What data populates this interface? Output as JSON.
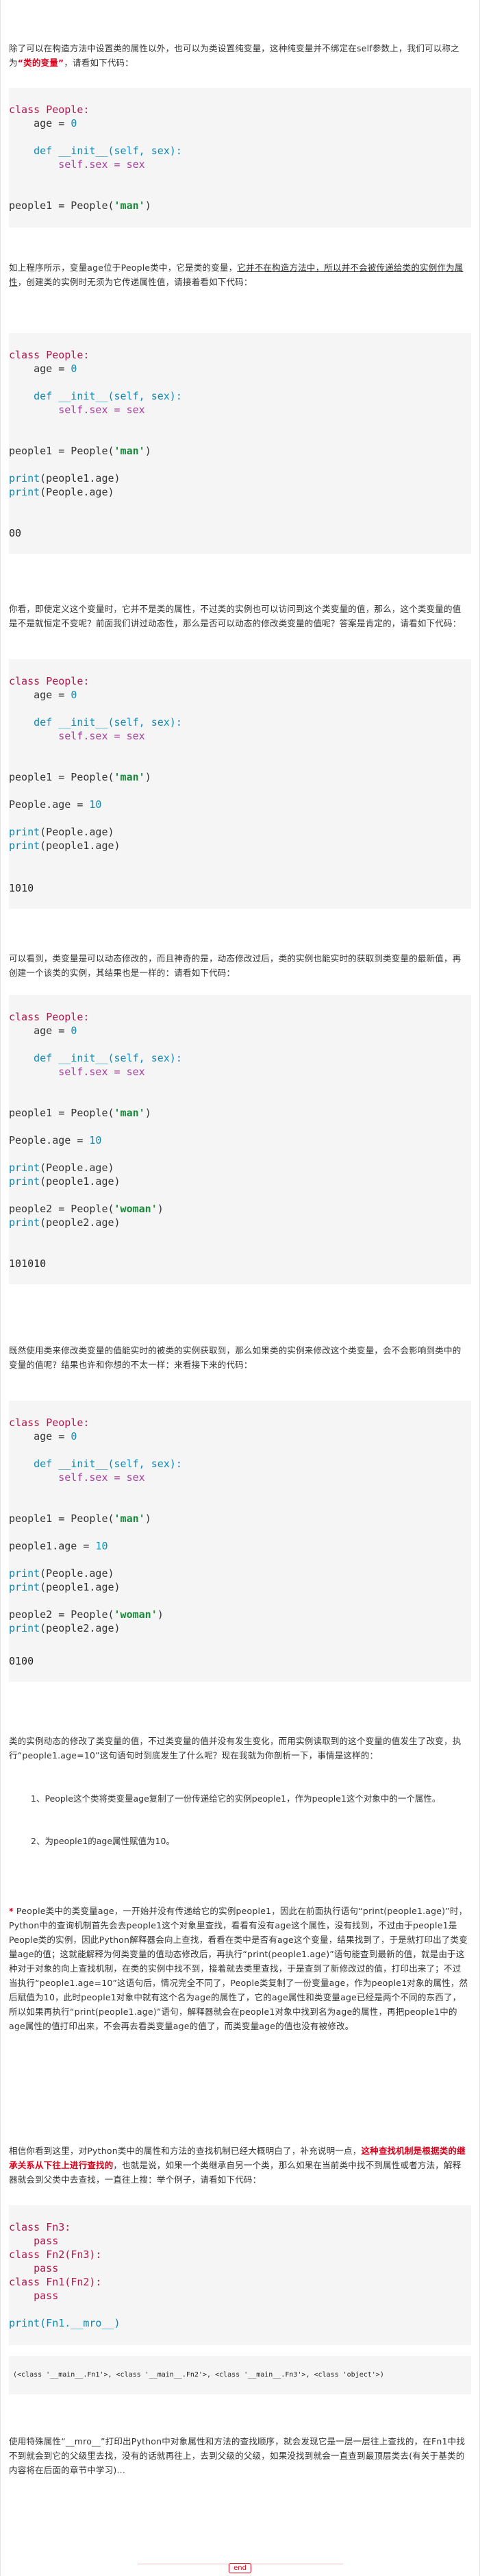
{
  "intro": {
    "p1_a": "除了可以在构造方法中设置类的属性以外，也可以为类设置纯变量，这种纯变量并不绑定在self参数上，我们可以称之为",
    "p1_b": "“类的变量”",
    "p1_c": "，请看如下代码：",
    "p2_a": "如上程序所示，变量age位于People类中，它是类的变量，",
    "p2_b": "它并不在构造方法中，所以并不会被传递给类的实例作为属性",
    "p2_c": "，创建类的实例时无须为它传递属性值，请接着看如下代码：",
    "p3": "你看，即使定义这个变量时，它并不是类的属性，不过类的实例也可以访问到这个类变量的值，那么，这个类变量的值是不是就恒定不变呢？前面我们讲过动态性，那么是否可以动态的修改类变量的值呢？答案是肯定的，请看如下代码：",
    "p4": "可以看到，类变量是可以动态修改的，而且神奇的是，动态修改过后，类的实例也能实时的获取到类变量的最新值，再创建一个该类的实例，其结果也是一样的：请看如下代码：",
    "p5": "既然使用类来修改类变量的值能实时的被类的实例获取到，那么如果类的实例来修改这个类变量，会不会影响到类中的变量的值呢？结果也许和你想的不太一样：来看接下来的代码：",
    "p6": "类的实例动态的修改了类变量的值，不过类变量的值并没有发生变化，而用实例读取到的这个变量的值发生了改变，执行“people1.age=10”这句语句时到底发生了什么呢？现在我就为你剖析一下，事情是这样的：",
    "list1": "1、People这个类将类变量age复制了一份传递给它的实例people1，作为people1这个对象中的一个属性。",
    "list2": "2、为people1的age属性赋值为10。",
    "p7_star": "*",
    "p7": " People类中的类变量age，一开始并没有传递给它的实例people1，因此在前面执行语句“print(people1.age)”时，Python中的查询机制首先会去people1这个对象里查找，看看有没有age这个属性，没有找到，不过由于people1是People类的实例，因此Python解释器会向上查找，看看在类中是否有age这个变量，结果找到了，于是就打印出了类变量age的值；这就能解释为何类变量的值动态修改后，再执行“print(people1.age)”语句能查到最新的值，就是由于这种对于对象的向上查找机制，在类的实例中找不到，接着就去类里查找，于是查到了新修改过的值，打印出来了；不过当执行“people1.age=10”这语句后，情况完全不同了，People类复制了一份变量age，作为people1对象的属性，然后赋值为10，此时people1对象中就有这个名为age的属性了，它的age属性和类变量age已经是两个不同的东西了，所以如果再执行“print(people1.age)”语句，解释器就会在people1对象中找到名为age的属性，再把people1中的age属性的值打印出来，不会再去看类变量age的值了，而类变量age的值也没有被修改。",
    "p8_a": "相信你看到这里，对Python类中的属性和方法的查找机制已经大概明白了，补充说明一点，",
    "p8_b": "这种查找机制是根据类的继承关系从下往上进行查找的",
    "p8_c": "，也就是说，如果一个类继承自另一个类，那么如果在当前类中找不到属性或者方法，解释器就会到父类中去查找，一直往上搜：举个例子，请看如下代码：",
    "p9": "使用特殊属性“__mro__”打印出Python中对象属性和方法的查找顺序，就会发现它是一层一层往上查找的，在Fn1中找不到就会到它的父级里去找，没有的话就再往上，去到父级的父级，如果没找到就会一直查到最顶层类去(有关于基类的内容将在后面的章节中学习)..."
  },
  "code": {
    "class_kw": "class",
    "def_kw": "def",
    "pass_kw": "pass",
    "print_fn": "print",
    "people_cls": "People:",
    "age0": "    age = 0",
    "init_def": "__init__(self, sex):",
    "self_sex": "self.sex = sex",
    "people1_man": "people1 = People('man')",
    "print_people1_age": "print(people1.age)",
    "print_People_age": "print(People.age)",
    "People_age_10": "People.age = 10",
    "people2_woman": "people2 = People('woman')",
    "print_people2_age": "print(people2.age)",
    "people1_age_10": "people1.age = 10",
    "fn3": "Fn3:",
    "fn2": "Fn2(Fn3):",
    "fn1": "Fn1(Fn2):",
    "mro": "print(Fn1.__mro__)"
  },
  "outputs": {
    "o1": [
      "0",
      "0"
    ],
    "o2": [
      "10",
      "10"
    ],
    "o3": [
      "10",
      "10",
      "10"
    ],
    "o4": [
      "0",
      "10",
      "0"
    ],
    "mro_out": "(<class '__main__.Fn1'>, <class '__main__.Fn2'>, <class '__main__.Fn3'>, <class 'object'>)"
  },
  "footer": {
    "end_label": "end"
  },
  "colors": {
    "keyword": "#b5174a",
    "string": "#1a8a3a",
    "number": "#0a8bb8",
    "highlight": "#d9001b",
    "code_bg": "#f5f5f5"
  }
}
